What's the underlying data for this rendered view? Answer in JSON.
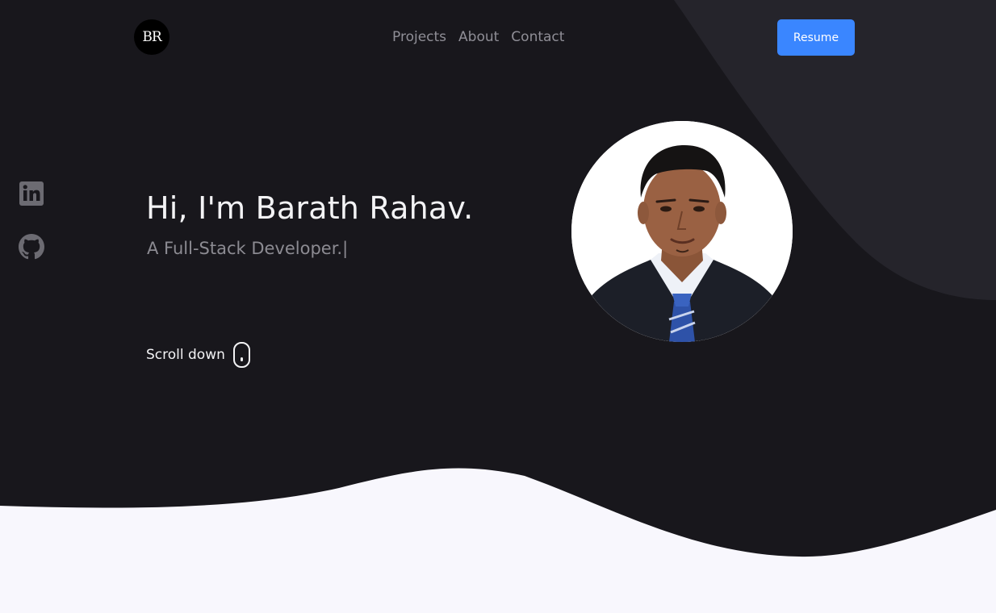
{
  "header": {
    "logo_text": "BR",
    "nav": [
      {
        "label": "Projects"
      },
      {
        "label": "About"
      },
      {
        "label": "Contact"
      }
    ],
    "resume_label": "Resume"
  },
  "socials": [
    {
      "icon": "linkedin-icon"
    },
    {
      "icon": "github-icon"
    }
  ],
  "hero": {
    "title": "Hi, I'm Barath Rahav.",
    "subtitle": "A Full-Stack Developer.",
    "cursor": "|",
    "scroll_label": "Scroll down"
  },
  "colors": {
    "background_dark": "#18171c",
    "background_shape": "#25242b",
    "background_light": "#f8f7fd",
    "accent": "#3a86ff",
    "text_primary": "#f3f3f5",
    "text_muted": "#8c8b92"
  }
}
